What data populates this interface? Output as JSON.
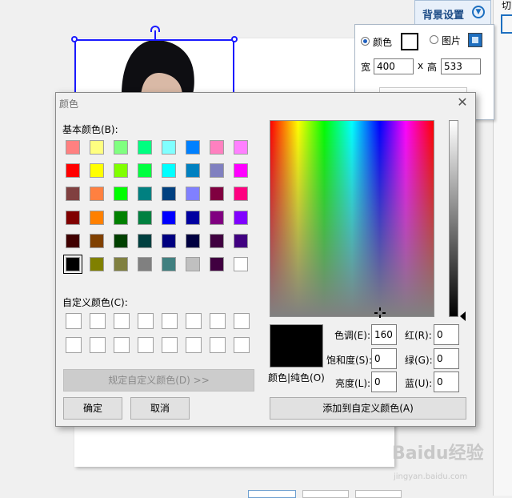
{
  "panel": {
    "tab_title": "背景设置",
    "partial_label": "切",
    "color_radio": "颜色",
    "image_radio": "图片",
    "width_label": "宽",
    "width_value": "400",
    "times": "x",
    "height_label": "高",
    "height_value": "533"
  },
  "dialog": {
    "title": "颜色",
    "basic_colors_label": "基本颜色(B):",
    "custom_colors_label": "自定义颜色(C):",
    "define_custom_button": "规定自定义颜色(D) >>",
    "ok_button": "确定",
    "cancel_button": "取消",
    "add_custom_button": "添加到自定义颜色(A)",
    "solid_label": "颜色|纯色(O)",
    "hue_label": "色调(E):",
    "hue_value": "160",
    "sat_label": "饱和度(S):",
    "sat_value": "0",
    "lum_label": "亮度(L):",
    "lum_value": "0",
    "red_label": "红(R):",
    "red_value": "0",
    "green_label": "绿(G):",
    "green_value": "0",
    "blue_label": "蓝(U):",
    "blue_value": "0",
    "basic_colors": [
      "#ff8080",
      "#ffff80",
      "#80ff80",
      "#00ff80",
      "#80ffff",
      "#0080ff",
      "#ff80c0",
      "#ff80ff",
      "#ff0000",
      "#ffff00",
      "#80ff00",
      "#00ff40",
      "#00ffff",
      "#0080c0",
      "#8080c0",
      "#ff00ff",
      "#804040",
      "#ff8040",
      "#00ff00",
      "#008080",
      "#004080",
      "#8080ff",
      "#800040",
      "#ff0080",
      "#800000",
      "#ff8000",
      "#008000",
      "#008040",
      "#0000ff",
      "#0000a0",
      "#800080",
      "#8000ff",
      "#400000",
      "#804000",
      "#004000",
      "#004040",
      "#000080",
      "#000040",
      "#400040",
      "#400080",
      "#000000",
      "#808000",
      "#808040",
      "#808080",
      "#408080",
      "#c0c0c0",
      "#400040",
      "#ffffff"
    ],
    "selected_basic_index": 40
  },
  "watermark": {
    "text": "Baidu经验",
    "sub": "jingyan.baidu.com"
  }
}
